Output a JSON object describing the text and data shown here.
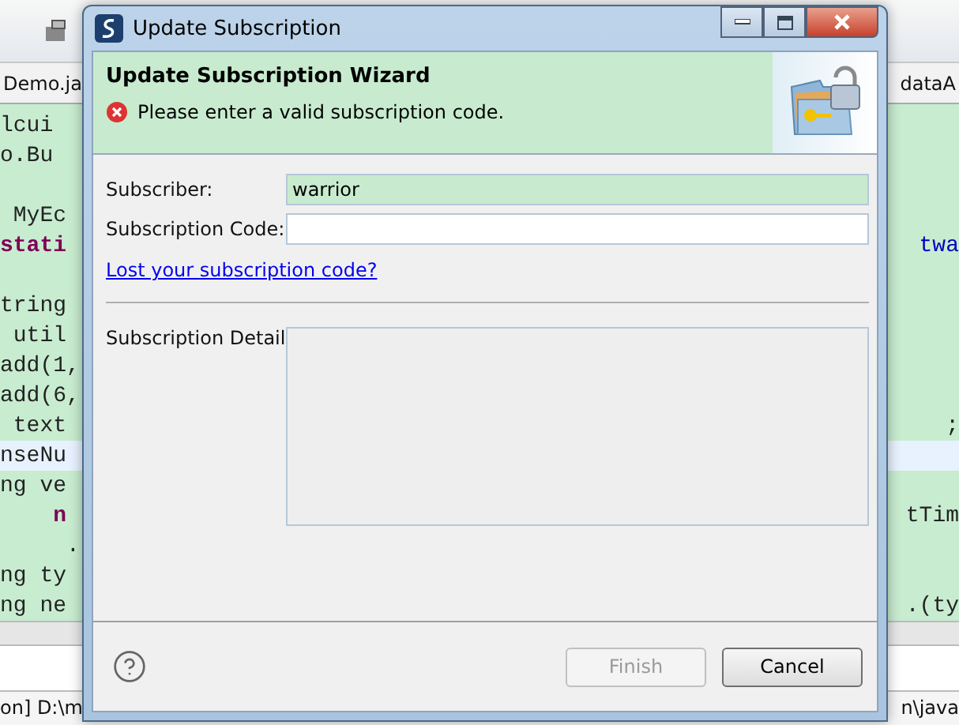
{
  "editor": {
    "tabs": [
      {
        "label": "Demo.ja"
      },
      {
        "label": "dataA"
      }
    ],
    "lines": [
      {
        "left": {
          "text": "lcui",
          "kind": "plain"
        },
        "current": false
      },
      {
        "left": {
          "text": "o.Bu",
          "kind": "plain"
        },
        "current": false
      },
      {
        "current": false
      },
      {
        "left": {
          "text": " MyEc",
          "kind": "plain"
        },
        "current": false
      },
      {
        "left": {
          "text": "stati",
          "kind": "keyword"
        },
        "right": {
          "text": "twa",
          "kind": "field"
        },
        "current": false
      },
      {
        "current": false
      },
      {
        "left": {
          "text": "tring",
          "kind": "plain"
        },
        "current": false
      },
      {
        "left": {
          "text": " util",
          "kind": "plain"
        },
        "current": false
      },
      {
        "left": {
          "text": "add(1,",
          "kind": "plain"
        },
        "current": false
      },
      {
        "left": {
          "text": "add(6,",
          "kind": "plain"
        },
        "current": false
      },
      {
        "left": {
          "text": " text",
          "kind": "plain"
        },
        "right": {
          "text": ";",
          "kind": "plain"
        },
        "current": false
      },
      {
        "left": {
          "text": "nseNu",
          "kind": "plain"
        },
        "current": true
      },
      {
        "left": {
          "text": "ng ve",
          "kind": "plain"
        },
        "current": false
      },
      {
        "left": {
          "text": "    n",
          "kind": "keyword"
        },
        "right": {
          "text": "tTim",
          "kind": "plain"
        },
        "current": false
      },
      {
        "left": {
          "text": "     .",
          "kind": "plain"
        },
        "current": false
      },
      {
        "left": {
          "text": "ng ty",
          "kind": "plain"
        },
        "current": false
      },
      {
        "left": {
          "text": "ng ne",
          "kind": "plain"
        },
        "right": {
          "text": ".(ty",
          "kind": "plain"
        },
        "current": false
      }
    ],
    "console": {
      "left": "on] D:\\m",
      "right": "n\\java"
    }
  },
  "dialog": {
    "title": "Update Subscription",
    "banner": {
      "heading": "Update Subscription Wizard",
      "message": "Please enter a valid subscription code."
    },
    "fields": [
      {
        "label": "Subscriber:",
        "value": "warrior",
        "highlighted": true
      },
      {
        "label": "Subscription Code:",
        "highlighted": false
      }
    ],
    "link": "Lost your subscription code?",
    "detail_label": "Subscription Detail",
    "buttons": [
      {
        "label": "Finish",
        "disabled": true
      },
      {
        "label": "Cancel",
        "disabled": false
      }
    ]
  }
}
